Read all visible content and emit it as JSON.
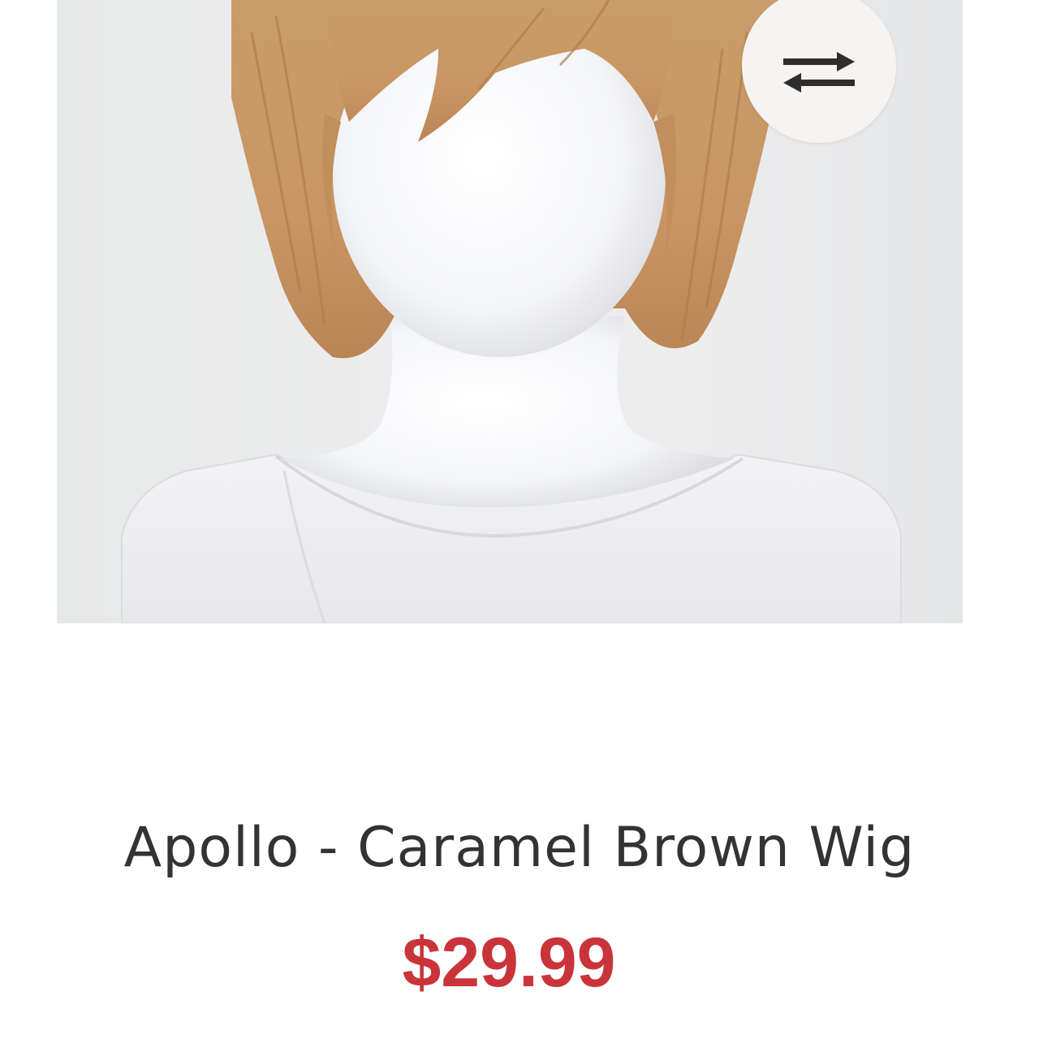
{
  "product": {
    "image_icon": "wig-on-mannequin-photo",
    "title": "Apollo - Caramel Brown Wig",
    "price": "$29.99"
  },
  "compare_button": {
    "icon": "swap-arrows-icon"
  },
  "colors": {
    "price": "#c9343a",
    "title": "#333333",
    "wig": "#c79a67",
    "icon": "#2e2e2e"
  }
}
